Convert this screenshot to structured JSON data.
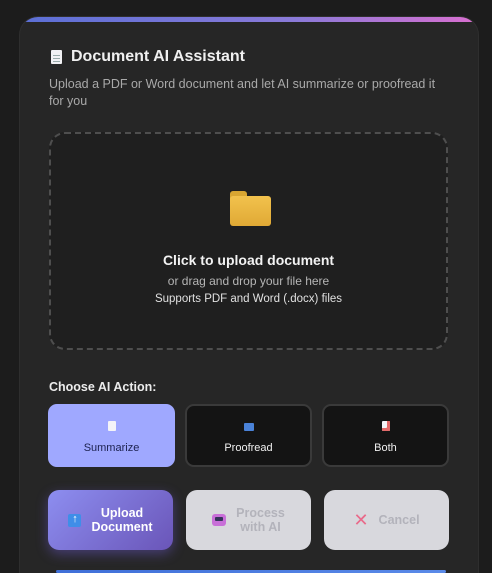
{
  "header": {
    "title": "Document AI Assistant",
    "subtitle": "Upload a PDF or Word document and let AI summarize or proofread it for you",
    "icon": "document-icon"
  },
  "dropzone": {
    "icon": "folder-icon",
    "title": "Click to upload document",
    "subtitle": "or drag and drop your file here",
    "note": "Supports PDF and Word (.docx) files"
  },
  "actions": {
    "heading": "Choose AI Action:",
    "options": [
      {
        "label": "Summarize",
        "icon": "page-icon",
        "selected": true
      },
      {
        "label": "Proofread",
        "icon": "abc-icon",
        "selected": false
      },
      {
        "label": "Both",
        "icon": "page-pencil-icon",
        "selected": false
      }
    ]
  },
  "buttons": {
    "upload": {
      "line1": "Upload",
      "line2": "Document",
      "icon": "upload-arrow-icon",
      "enabled": true
    },
    "process": {
      "line1": "Process",
      "line2": "with AI",
      "icon": "robot-icon",
      "enabled": false
    },
    "cancel": {
      "label": "Cancel",
      "icon": "x-icon",
      "enabled": false
    }
  },
  "colors": {
    "accent": "#9fa8ff",
    "upload_gradient_start": "#8d8ef0",
    "upload_gradient_end": "#6a55b8",
    "disabled_bg": "#d8d8dd",
    "card_bg": "#262626"
  }
}
